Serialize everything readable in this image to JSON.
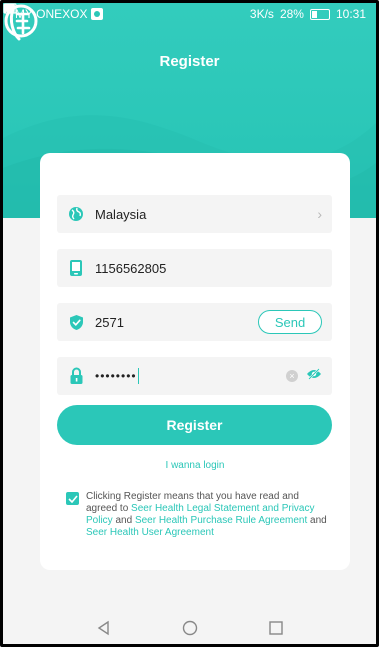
{
  "status_bar": {
    "carrier": "MY ONEXOX",
    "speed": "3K/s",
    "battery": "28%",
    "time": "10:31"
  },
  "header": {
    "title": "Register"
  },
  "form": {
    "country": "Malaysia",
    "phone": "1156562805",
    "code": "2571",
    "send_label": "Send",
    "password_mask": "••••••••"
  },
  "actions": {
    "register_label": "Register",
    "login_label": "I wanna login"
  },
  "agreement": {
    "checked": true,
    "part1": "Clicking Register means that you have read and agreed to",
    "link1": "Seer Health Legal Statement and Privacy Policy",
    "and1": "and",
    "link2": "Seer Health Purchase Rule Agreement",
    "and2": "and",
    "link3": "Seer Health User Agreement"
  },
  "icons": {
    "country": "globe-icon",
    "phone": "phone-icon",
    "code": "shield-icon",
    "password": "lock-icon",
    "visibility": "eye-slash-icon"
  },
  "colors": {
    "accent": "#2bc7b8",
    "field_bg": "#f4f4f4",
    "page_bg": "#f4f4f4"
  }
}
